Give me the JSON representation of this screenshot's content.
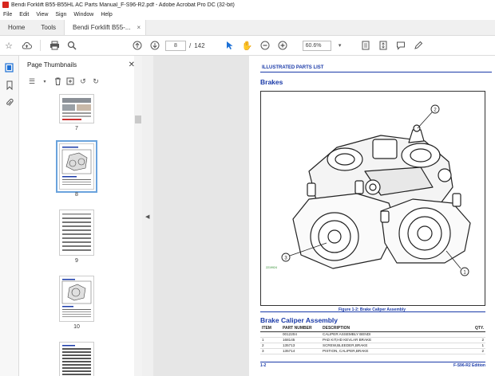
{
  "window": {
    "title": "Bendi Forklift B55-B55HL AC Parts Manual_F-S96-R2.pdf - Adobe Acrobat Pro DC (32-bit)"
  },
  "menu": [
    "File",
    "Edit",
    "View",
    "Sign",
    "Window",
    "Help"
  ],
  "tabs": {
    "home": "Home",
    "tools": "Tools",
    "document": "Bendi Forklift B55-...",
    "document_close": "×"
  },
  "toolbar": {
    "page_current": "8",
    "page_sep": "/",
    "page_total": "142",
    "zoom": "60.6%"
  },
  "thumbnails": {
    "panel_title": "Page Thumbnails",
    "close": "✕",
    "pages": [
      "7",
      "8",
      "9",
      "10"
    ],
    "selected_page": "8"
  },
  "document": {
    "section_header": "ILLUSTRATED PARTS LIST",
    "heading": "Brakes",
    "figure_code": "2219924",
    "callouts": [
      "1",
      "2",
      "3"
    ],
    "figure_caption": "Figure 1-2:  Brake Caliper Assembly",
    "table_title": "Brake Caliper Assembly",
    "table_headers": {
      "item": "ITEM",
      "part": "PART NUMBER",
      "desc": "DESCRIPTION",
      "qty": "QTY."
    },
    "rows": [
      {
        "item": "",
        "part": "0012204",
        "desc": "CALIPER ASSEMBLY BENDI",
        "qty": ""
      },
      {
        "item": "1",
        "part": "168145",
        "desc": "PAD KIT,HD KEVLAR BRAKE",
        "qty": "2"
      },
      {
        "item": "2",
        "part": "135713",
        "desc": "SCREW,BLEEDER,BRAKE",
        "qty": "1"
      },
      {
        "item": "3",
        "part": "135714",
        "desc": "PISTION, CALIPER,BRAKE",
        "qty": "2"
      }
    ],
    "footer_left": "1-2",
    "footer_right": "F-S96-R2 Edition"
  },
  "colors": {
    "accent_blue": "#1a3aa8",
    "selection_blue": "#1a6fd6",
    "acrobat_red": "#d7261e"
  }
}
